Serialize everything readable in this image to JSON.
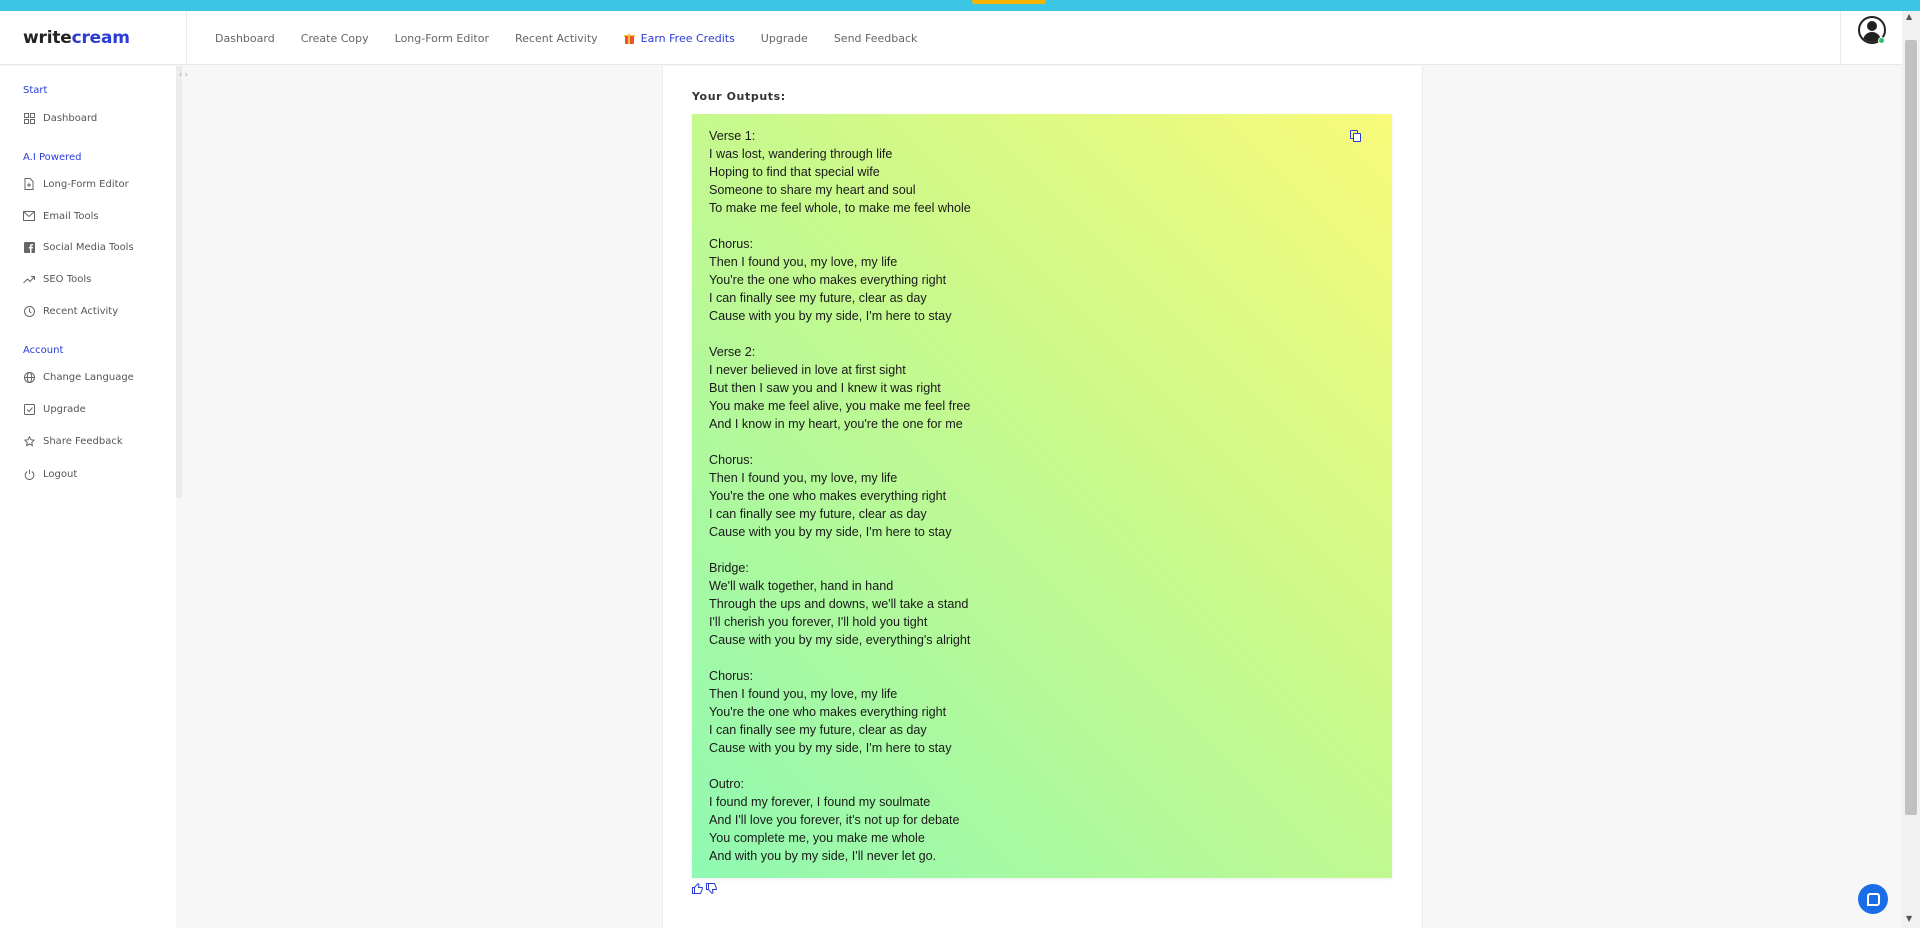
{
  "app": {
    "logo_write": "write",
    "logo_cream": "cream"
  },
  "nav": {
    "items": [
      {
        "label": "Dashboard"
      },
      {
        "label": "Create Copy"
      },
      {
        "label": "Long-Form Editor"
      },
      {
        "label": "Recent Activity"
      },
      {
        "label": "Earn Free Credits",
        "icon": "gift-icon"
      },
      {
        "label": "Upgrade"
      },
      {
        "label": "Send Feedback"
      }
    ]
  },
  "sidebar": {
    "sections": [
      {
        "title": "Start"
      },
      {
        "title": "A.I Powered"
      },
      {
        "title": "Account"
      }
    ],
    "items": [
      {
        "label": "Dashboard",
        "icon": "grid-icon"
      },
      {
        "label": "Long-Form Editor",
        "icon": "document-icon"
      },
      {
        "label": "Email Tools",
        "icon": "mail-icon"
      },
      {
        "label": "Social Media Tools",
        "icon": "facebook-icon"
      },
      {
        "label": "SEO Tools",
        "icon": "trending-up-icon"
      },
      {
        "label": "Recent Activity",
        "icon": "clock-icon"
      },
      {
        "label": "Change Language",
        "icon": "globe-icon"
      },
      {
        "label": "Upgrade",
        "icon": "check-square-icon"
      },
      {
        "label": "Share Feedback",
        "icon": "star-icon"
      },
      {
        "label": "Logout",
        "icon": "power-icon"
      }
    ]
  },
  "main": {
    "outputs_title": "Your Outputs:",
    "output_text": "Verse 1:\nI was lost, wandering through life\nHoping to find that special wife\nSomeone to share my heart and soul\nTo make me feel whole, to make me feel whole\n\nChorus:\nThen I found you, my love, my life\nYou're the one who makes everything right\nI can finally see my future, clear as day\nCause with you by my side, I'm here to stay\n\nVerse 2:\nI never believed in love at first sight\nBut then I saw you and I knew it was right\nYou make me feel alive, you make me feel free\nAnd I know in my heart, you're the one for me\n\nChorus:\nThen I found you, my love, my life\nYou're the one who makes everything right\nI can finally see my future, clear as day\nCause with you by my side, I'm here to stay\n\nBridge:\nWe'll walk together, hand in hand\nThrough the ups and downs, we'll take a stand\nI'll cherish you forever, I'll hold you tight\nCause with you by my side, everything's alright\n\nChorus:\nThen I found you, my love, my life\nYou're the one who makes everything right\nI can finally see my future, clear as day\nCause with you by my side, I'm here to stay\n\nOutro:\nI found my forever, I found my soulmate\nAnd I'll love you forever, it's not up for debate\nYou complete me, you make me whole\nAnd with you by my side, I'll never let go.",
    "thumbs_up": "👍",
    "thumbs_down": "👎"
  },
  "colors": {
    "accent": "#2a3bd6",
    "topbar": "#3cc6e6",
    "gradient_start": "#f8fa7a",
    "gradient_end": "#8ff9b2"
  }
}
